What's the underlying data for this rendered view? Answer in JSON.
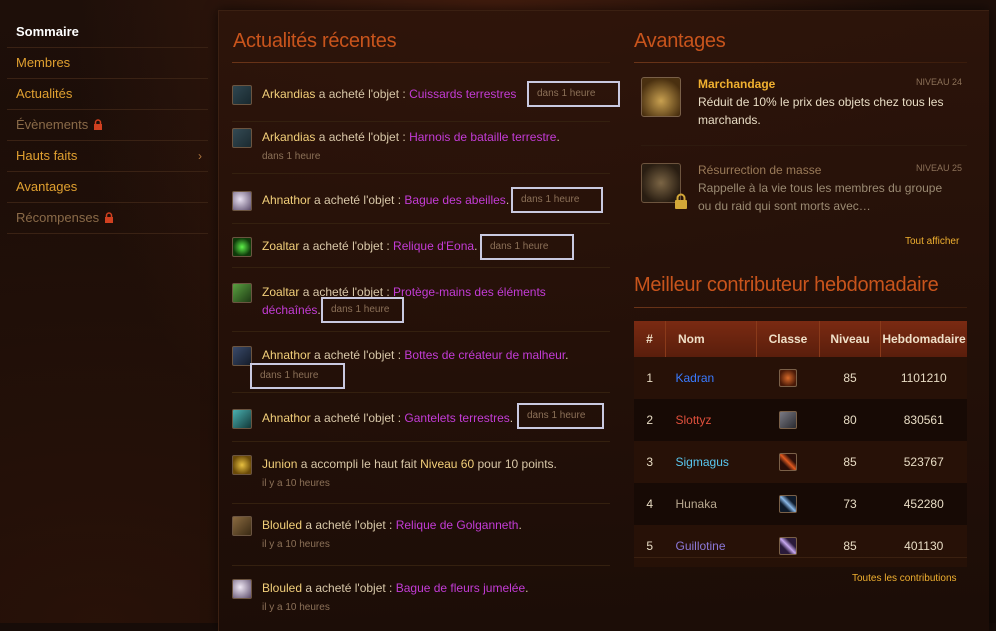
{
  "sidebar": {
    "items": [
      {
        "label": "Sommaire",
        "state": "active"
      },
      {
        "label": "Membres",
        "state": "normal"
      },
      {
        "label": "Actualités",
        "state": "normal"
      },
      {
        "label": "Évènements",
        "state": "disabled",
        "icon": "lock-icon"
      },
      {
        "label": "Hauts faits",
        "state": "normal",
        "icon": "chevron-right-icon"
      },
      {
        "label": "Avantages",
        "state": "normal"
      },
      {
        "label": "Récompenses",
        "state": "disabled",
        "icon": "lock-icon"
      }
    ]
  },
  "news": {
    "title": "Actualités récentes",
    "items": [
      {
        "who": "Arkandias",
        "verb": " a acheté l'objet : ",
        "object": "Cuissards terrestres",
        "after": "",
        "when": "dans 1 heure",
        "icon": "armor-legs-icon"
      },
      {
        "who": "Arkandias",
        "verb": " a acheté l'objet : ",
        "object": "Harnois de bataille terrestre",
        "after": ".",
        "when": "dans 1 heure",
        "icon": "armor-chest-icon"
      },
      {
        "who": "Ahnathor",
        "verb": " a acheté l'objet : ",
        "object": "Bague des abeilles",
        "after": ".",
        "when": "dans 1 heure",
        "icon": "ring-icon"
      },
      {
        "who": "Zoaltar",
        "verb": " a acheté l'objet : ",
        "object": "Relique d'Eona",
        "after": ".",
        "when": "dans 1 heure",
        "icon": "relic-orb-icon"
      },
      {
        "who": "Zoaltar",
        "verb": " a acheté l'objet : ",
        "object": "Protège-mains des éléments déchaînés",
        "after": ".",
        "when": "dans 1 heure",
        "icon": "gloves-icon"
      },
      {
        "who": "Ahnathor",
        "verb": " a acheté l'objet : ",
        "object": "Bottes de créateur de malheur",
        "after": ".",
        "when": "dans 1 heure",
        "icon": "boots-icon"
      },
      {
        "who": "Ahnathor",
        "verb": " a acheté l'objet : ",
        "object": "Gantelets terrestres",
        "after": ".",
        "when": "dans 1 heure",
        "icon": "gauntlets-icon"
      },
      {
        "who": "Junion",
        "verb": " a accompli le haut fait ",
        "achievement": "Niveau 60",
        "after": " pour 10 points.",
        "when": "il y a 10 heures",
        "icon": "achievement-coin-icon"
      },
      {
        "who": "Blouled",
        "verb": " a acheté l'objet : ",
        "object": "Relique de Golganneth",
        "after": ".",
        "when": "il y a 10 heures",
        "icon": "relic-book-icon"
      },
      {
        "who": "Blouled",
        "verb": " a acheté l'objet : ",
        "object": "Bague de fleurs jumelée",
        "after": ".",
        "when": "il y a 10 heures",
        "icon": "ring-icon"
      }
    ]
  },
  "perks": {
    "title": "Avantages",
    "items": [
      {
        "name": "Marchandage",
        "level": "NIVEAU 24",
        "desc": "Réduit de 10% le prix des objets chez tous les marchands.",
        "locked": false,
        "icon": "coins-hand-icon"
      },
      {
        "name": "Résurrection de masse",
        "level": "NIVEAU 25",
        "desc": "Rappelle à la vie tous les membres du groupe ou du raid qui sont morts avec…",
        "locked": true,
        "icon": "resurrection-icon"
      }
    ],
    "show_all": "Tout afficher"
  },
  "contrib": {
    "title": "Meilleur contributeur hebdomadaire",
    "headers": [
      "#",
      "Nom",
      "Classe",
      "Niveau",
      "Hebdomadaire"
    ],
    "rows": [
      {
        "rank": "1",
        "name": "Kadran",
        "name_color": "#3a7bff",
        "class_icon": "class-warlock-icon",
        "level": "85",
        "weekly": "1101210"
      },
      {
        "rank": "2",
        "name": "Slottyz",
        "name_color": "#e0503c",
        "class_icon": "class-warrior-icon",
        "level": "80",
        "weekly": "830561"
      },
      {
        "rank": "3",
        "name": "Sigmagus",
        "name_color": "#59c8f0",
        "class_icon": "class-mage-icon",
        "level": "85",
        "weekly": "523767"
      },
      {
        "rank": "4",
        "name": "Hunaka",
        "name_color": "#b8a890",
        "class_icon": "class-hunter-icon",
        "level": "73",
        "weekly": "452280"
      },
      {
        "rank": "5",
        "name": "Guillotine",
        "name_color": "#8c78d8",
        "class_icon": "class-rogue-icon",
        "level": "85",
        "weekly": "401130"
      }
    ],
    "all_link": "Toutes les contributions"
  }
}
